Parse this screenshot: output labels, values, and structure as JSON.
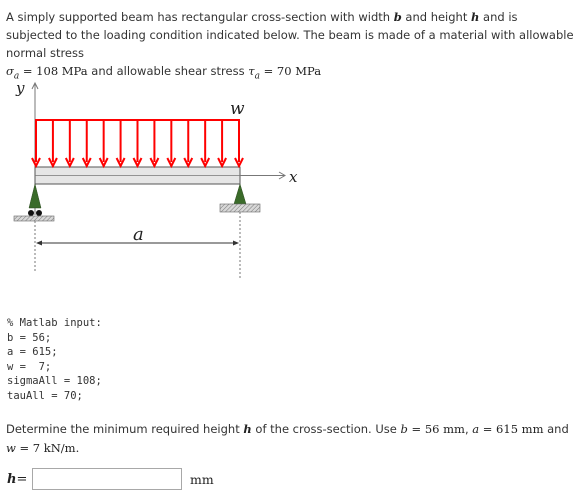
{
  "intro": {
    "p1": "A simply supported beam has rectangular cross-section with width ",
    "var_b": "b",
    "p2": " and height ",
    "var_h": "h",
    "p3": " and is subjected to the loading condition indicated below. The beam is made of a material with allowable normal stress ",
    "sigma_sym": "σ",
    "sigma_sub": "a",
    "sigma_val": " = 108 MPa",
    "p4": " and allowable shear stress ",
    "tau_sym": "τ",
    "tau_sub": "a",
    "tau_val": " = 70 MPa"
  },
  "diagram": {
    "y_label": "y",
    "x_label": "x",
    "load_label": "w",
    "span_label": "a",
    "load_color": "#ff0000",
    "support_color": "#3a6b2a",
    "arrow_count": 13
  },
  "code": {
    "lines": [
      "% Matlab input:",
      "b = 56;",
      "a = 615;",
      "w =  7;",
      "sigmaAll = 108;",
      "tauAll = 70;"
    ]
  },
  "question": {
    "p1": "Determine the minimum required height ",
    "var_h": "h",
    "p2": " of the cross-section. Use ",
    "b_eq": "b",
    "b_val": " = 56 mm",
    "sep1": ", ",
    "a_eq": "a",
    "a_val": " = 615 mm",
    "p3": " and ",
    "w_eq": "w",
    "w_val": " = 7 kN/m",
    "end": "."
  },
  "answer": {
    "label_var": "h",
    "label_eq": "=",
    "value": "",
    "placeholder": "",
    "unit": "mm"
  }
}
